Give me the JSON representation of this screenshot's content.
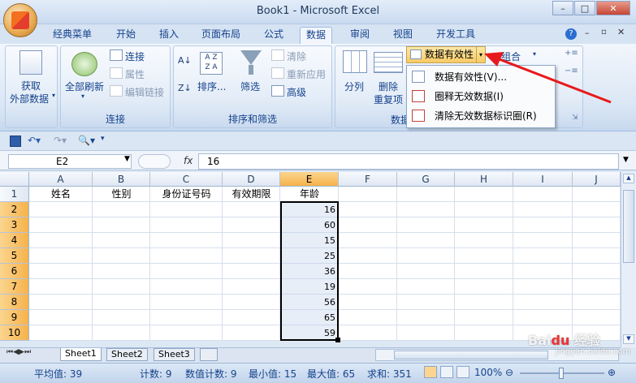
{
  "window": {
    "title": "Book1 - Microsoft Excel",
    "min": "–",
    "max": "□",
    "close": "✕"
  },
  "tabs": [
    "经典菜单",
    "开始",
    "插入",
    "页面布局",
    "公式",
    "数据",
    "审阅",
    "视图",
    "开发工具"
  ],
  "active_tab": "数据",
  "ribbon": {
    "get_external": "获取\n外部数据",
    "get_external_line1": "获取",
    "get_external_line2": "外部数据",
    "refresh_all": "全部刷新",
    "connections": "连接",
    "properties": "属性",
    "edit_links": "编辑链接",
    "group_connections": "连接",
    "sort": "排序...",
    "filter": "筛选",
    "clear": "清除",
    "reapply": "重新应用",
    "advanced": "高级",
    "group_sort_filter": "排序和筛选",
    "text_to_columns": "分列",
    "remove_duplicates_1": "删除",
    "remove_duplicates_2": "重复项",
    "group_data_tools_partial": "数据",
    "data_validation": "数据有效性",
    "group": "组合"
  },
  "dropdown_menu": {
    "items": [
      "数据有效性(V)...",
      "圈释无效数据(I)",
      "清除无效数据标识圈(R)"
    ]
  },
  "name_box": "E2",
  "formula_bar": {
    "fx": "fx",
    "value": "16"
  },
  "columns": [
    "A",
    "B",
    "C",
    "D",
    "E",
    "F",
    "G",
    "H",
    "I",
    "J"
  ],
  "rows": [
    "1",
    "2",
    "3",
    "4",
    "5",
    "6",
    "7",
    "8",
    "9",
    "10"
  ],
  "headers": {
    "A": "姓名",
    "B": "性别",
    "C": "身份证号码",
    "D": "有效期限",
    "E": "年龄"
  },
  "age_values": [
    "16",
    "60",
    "15",
    "25",
    "36",
    "19",
    "56",
    "65",
    "59"
  ],
  "sheets": [
    "Sheet1",
    "Sheet2",
    "Sheet3"
  ],
  "status": {
    "average": "平均值: 39",
    "count": "计数: 9",
    "numeric_count": "数值计数: 9",
    "min": "最小值: 15",
    "max": "最大值: 65",
    "sum": "求和: 351",
    "zoom": "100%"
  },
  "watermark": "Baidu 经验 jingyan.baidu.com"
}
